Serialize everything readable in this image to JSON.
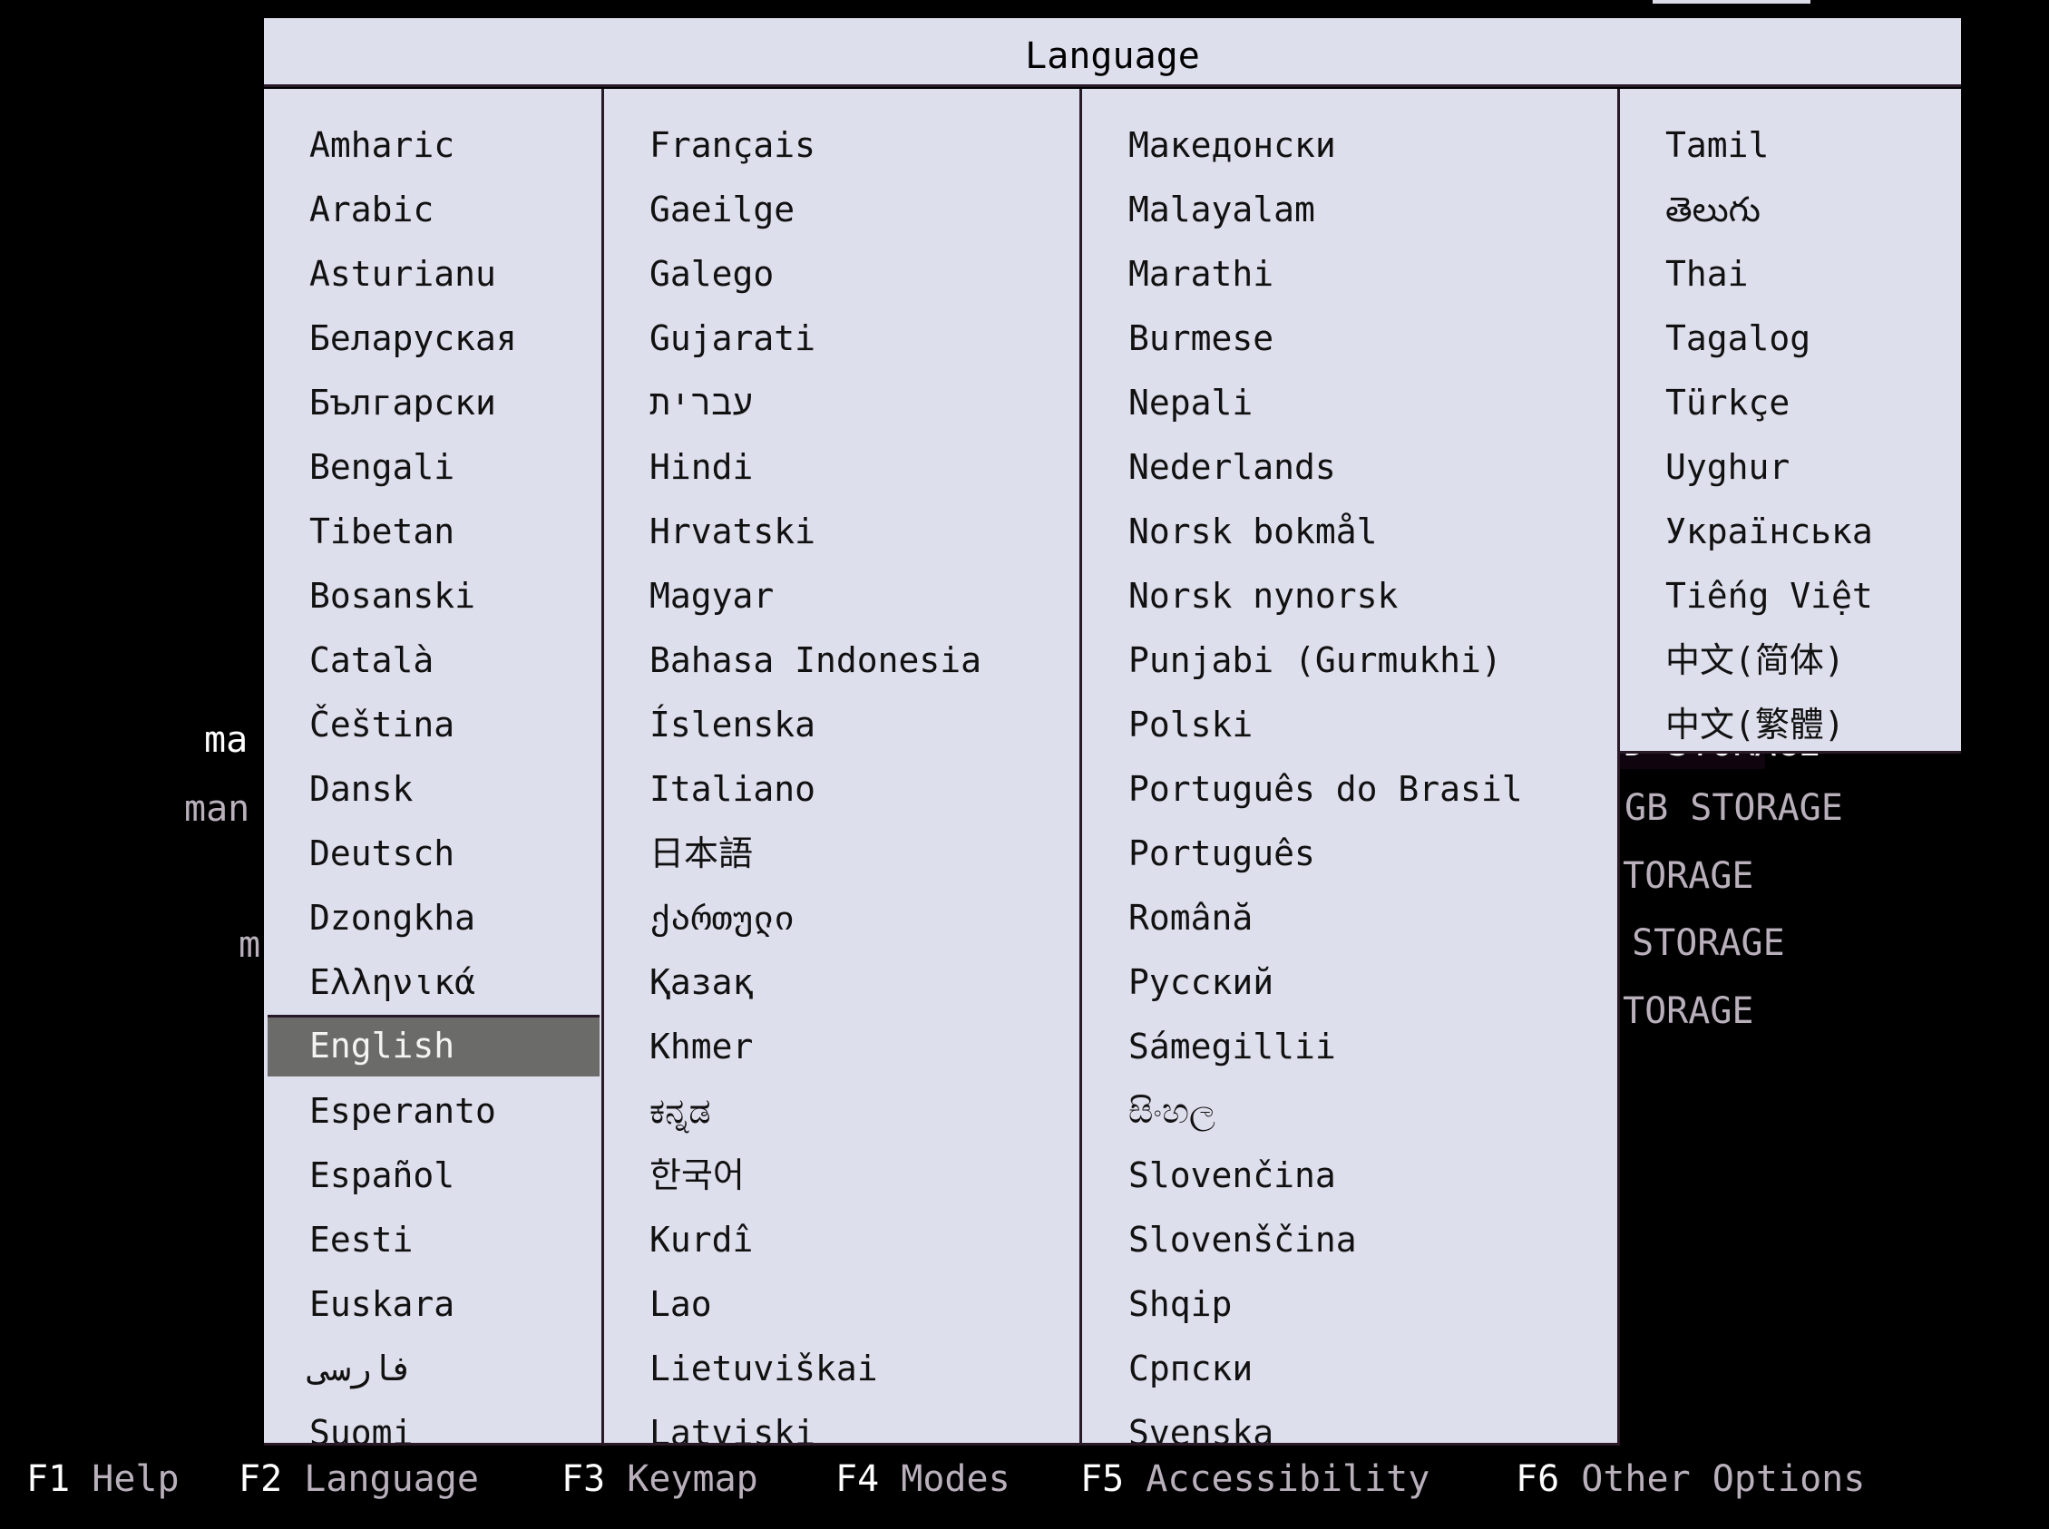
{
  "dialog": {
    "title": "Language",
    "selected": "English",
    "columns": [
      [
        "Amharic",
        "Arabic",
        "Asturianu",
        "Беларуская",
        "Български",
        "Bengali",
        "Tibetan",
        "Bosanski",
        "Català",
        "Čeština",
        "Dansk",
        "Deutsch",
        "Dzongkha",
        "Ελληνικά",
        "English",
        "Esperanto",
        "Español",
        "Eesti",
        "Euskara",
        "فارسی",
        "Suomi"
      ],
      [
        "Français",
        "Gaeilge",
        "Galego",
        "Gujarati",
        "עברית",
        "Hindi",
        "Hrvatski",
        "Magyar",
        "Bahasa Indonesia",
        "Íslenska",
        "Italiano",
        "日本語",
        "ქართული",
        "Қазақ",
        "Khmer",
        "ಕನ್ನಡ",
        "한국어",
        "Kurdî",
        "Lao",
        "Lietuviškai",
        "Latviski"
      ],
      [
        "Македонски",
        "Malayalam",
        "Marathi",
        "Burmese",
        "Nepali",
        "Nederlands",
        "Norsk bokmål",
        "Norsk nynorsk",
        "Punjabi (Gurmukhi)",
        "Polski",
        "Português do Brasil",
        "Português",
        "Română",
        "Русский",
        "Sámegillii",
        "සිංහල",
        "Slovenčina",
        "Slovenščina",
        "Shqip",
        "Српски",
        "Svenska"
      ],
      [
        "Tamil",
        "తెలుగు",
        "Thai",
        "Tagalog",
        "Türkçe",
        "Uyghur",
        "Українська",
        "Tiếng Việt",
        "中文(简体)",
        "中文(繁體)"
      ]
    ]
  },
  "background": {
    "left_fragments": [
      "ma",
      "man",
      "m"
    ],
    "right_fragments": [
      "D STORAGE",
      "GB STORAGE",
      "TORAGE",
      " STORAGE",
      "TORAGE"
    ]
  },
  "function_keys": [
    {
      "key": "F1",
      "label": "Help"
    },
    {
      "key": "F2",
      "label": "Language"
    },
    {
      "key": "F3",
      "label": "Keymap"
    },
    {
      "key": "F4",
      "label": "Modes"
    },
    {
      "key": "F5",
      "label": "Accessibility"
    },
    {
      "key": "F6",
      "label": "Other Options"
    }
  ],
  "colors": {
    "background": "#000000",
    "dialog": "#dedfec",
    "selection": "#6b6c69",
    "border": "#2a1a28",
    "dim_text": "#b9b0bc"
  }
}
